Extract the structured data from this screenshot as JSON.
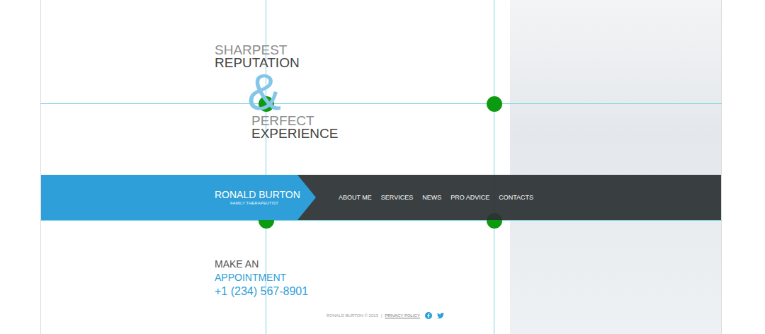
{
  "hero": {
    "line1": "SHARPEST",
    "line2": "REPUTATION",
    "ampersand": "&",
    "line3": "PERFECT",
    "line4": "EXPERIENCE"
  },
  "brand": {
    "name": "RONALD BURTON",
    "subtitle": "FAMILY THERAPEUTIST"
  },
  "nav": [
    {
      "label": "ABOUT ME",
      "selected": false
    },
    {
      "label": "SERVICES",
      "selected": false
    },
    {
      "label": "NEWS",
      "selected": false
    },
    {
      "label": "PRO ADVICE",
      "selected": false
    },
    {
      "label": "CONTACTS",
      "selected": false
    }
  ],
  "appointment": {
    "line1": "MAKE AN",
    "line2": "APPOINTMENT",
    "phone": "+1 (234) 567-8901"
  },
  "footer": {
    "copyright": "RONALD BURTON © 2013",
    "separator": "|",
    "link": "PRIVACY POLICY"
  }
}
